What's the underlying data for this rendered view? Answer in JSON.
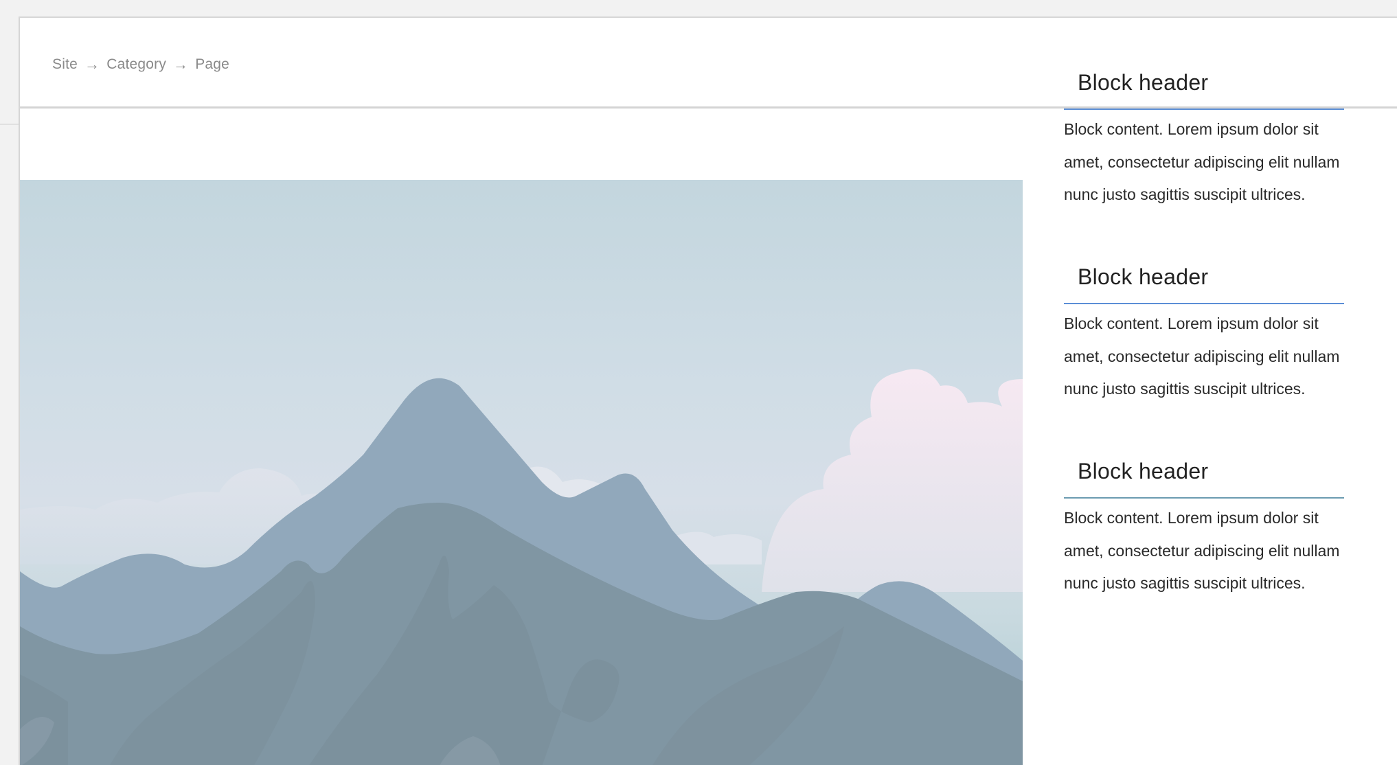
{
  "breadcrumb": {
    "items": [
      "Site",
      "Category",
      "Page"
    ],
    "separator": "→"
  },
  "hero": {
    "icon": "mountain-landscape-image"
  },
  "sidebar": {
    "blocks": [
      {
        "header": "Block header",
        "content": "Block content. Lorem ipsum dolor sit amet, consectetur adipiscing elit nullam nunc justo sagittis suscipit ultrices."
      },
      {
        "header": "Block header",
        "content": "Block content. Lorem ipsum dolor sit amet, consectetur adipiscing elit nullam nunc justo sagittis suscipit ultrices."
      },
      {
        "header": "Block header",
        "content": "Block content. Lorem ipsum dolor sit amet, consectetur adipiscing elit nullam nunc justo sagittis suscipit ultrices."
      }
    ]
  },
  "colors": {
    "accent": "#5b8ed6",
    "accent_alt": "#6b9bb0",
    "breadcrumb_text": "#8a8a8a",
    "sky_top": "#c3d6de",
    "mountain_far": "#91a8bb",
    "mountain_near": "#8096a3"
  }
}
